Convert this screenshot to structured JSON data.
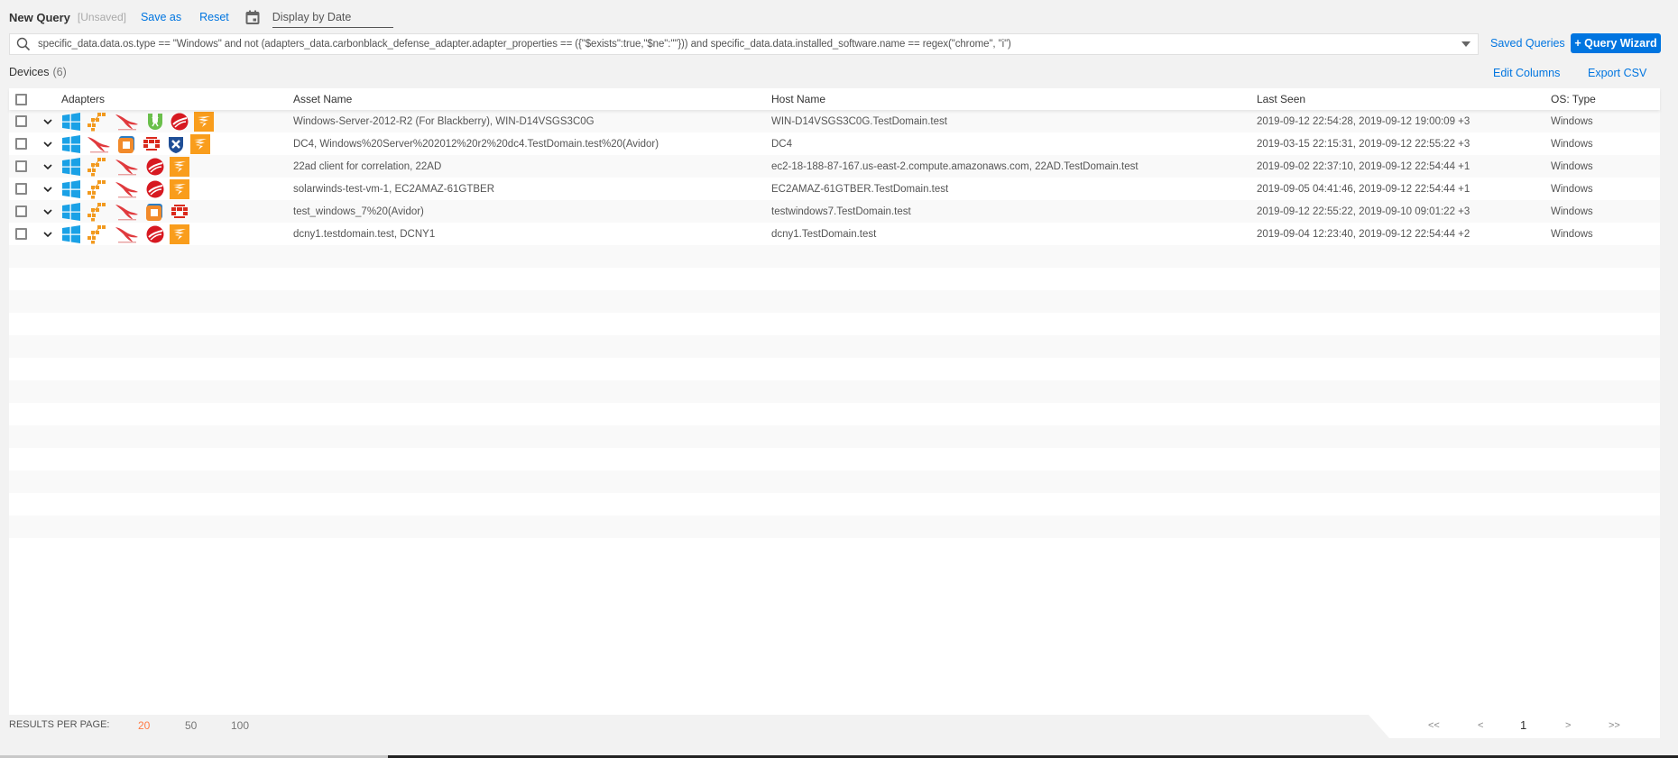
{
  "header": {
    "title": "New Query",
    "status": "[Unsaved]",
    "save_as": "Save as",
    "reset": "Reset",
    "date_placeholder": "Display by Date"
  },
  "search": {
    "query": "specific_data.data.os.type == \"Windows\" and not (adapters_data.carbonblack_defense_adapter.adapter_properties == ({\"$exists\":true,\"$ne\":\"\"})) and specific_data.data.installed_software.name == regex(\"chrome\", \"i\")"
  },
  "actions": {
    "saved_queries": "Saved Queries",
    "query_wizard": "+ Query Wizard",
    "edit_columns": "Edit Columns",
    "export_csv": "Export CSV"
  },
  "devices": {
    "label": "Devices",
    "count": "(6)"
  },
  "table": {
    "columns": [
      "Adapters",
      "Asset Name",
      "Host Name",
      "Last Seen",
      "OS: Type"
    ],
    "rows": [
      {
        "adapters": [
          "windows-icon",
          "aws-icon",
          "crowdstrike-icon",
          "cylance-icon",
          "trendmicro-icon",
          "solarwinds-icon"
        ],
        "asset_name": "Windows-Server-2012-R2 (For Blackberry), WIN-D14VSGS3C0G",
        "host_name": "WIN-D14VSGS3C0G.TestDomain.test",
        "last_seen": "2019-09-12 22:54:28, 2019-09-12 19:00:09 +3",
        "os_type": "Windows"
      },
      {
        "adapters": [
          "windows-icon",
          "crowdstrike-icon",
          "vmware-icon",
          "fortinet-icon",
          "sophos-icon",
          "solarwinds-icon"
        ],
        "asset_name": "DC4, Windows%20Server%202012%20r2%20dc4.TestDomain.test%20(Avidor)",
        "host_name": "DC4",
        "last_seen": "2019-03-15 22:15:31, 2019-09-12 22:55:22 +3",
        "os_type": "Windows"
      },
      {
        "adapters": [
          "windows-icon",
          "aws-icon",
          "crowdstrike-icon",
          "trendmicro-icon",
          "solarwinds-icon"
        ],
        "asset_name": "22ad client for correlation, 22AD",
        "host_name": "ec2-18-188-87-167.us-east-2.compute.amazonaws.com, 22AD.TestDomain.test",
        "last_seen": "2019-09-02 22:37:10, 2019-09-12 22:54:44 +1",
        "os_type": "Windows"
      },
      {
        "adapters": [
          "windows-icon",
          "aws-icon",
          "crowdstrike-icon",
          "trendmicro-icon",
          "solarwinds-icon"
        ],
        "asset_name": "solarwinds-test-vm-1, EC2AMAZ-61GTBER",
        "host_name": "EC2AMAZ-61GTBER.TestDomain.test",
        "last_seen": "2019-09-05 04:41:46, 2019-09-12 22:54:44 +1",
        "os_type": "Windows"
      },
      {
        "adapters": [
          "windows-icon",
          "aws-icon",
          "crowdstrike-icon",
          "vmware-icon",
          "fortinet-icon"
        ],
        "asset_name": "test_windows_7%20(Avidor)",
        "host_name": "testwindows7.TestDomain.test",
        "last_seen": "2019-09-12 22:55:22, 2019-09-10 09:01:22 +3",
        "os_type": "Windows"
      },
      {
        "adapters": [
          "windows-icon",
          "aws-icon",
          "crowdstrike-icon",
          "trendmicro-icon",
          "solarwinds-icon"
        ],
        "asset_name": "dcny1.testdomain.test, DCNY1",
        "host_name": "dcny1.TestDomain.test",
        "last_seen": "2019-09-04 12:23:40, 2019-09-12 22:54:44 +2",
        "os_type": "Windows"
      }
    ],
    "empty_rows": 14
  },
  "footer": {
    "results_per_page_label": "RESULTS PER PAGE:",
    "page_size_options": [
      "20",
      "50",
      "100"
    ],
    "selected_page_size": "20",
    "pager": {
      "first": "<<",
      "prev": "<",
      "current": "1",
      "next": ">",
      "last": ">>"
    }
  },
  "colors": {
    "accent": "#0075e0",
    "active_page_size": "#ff7a45"
  }
}
